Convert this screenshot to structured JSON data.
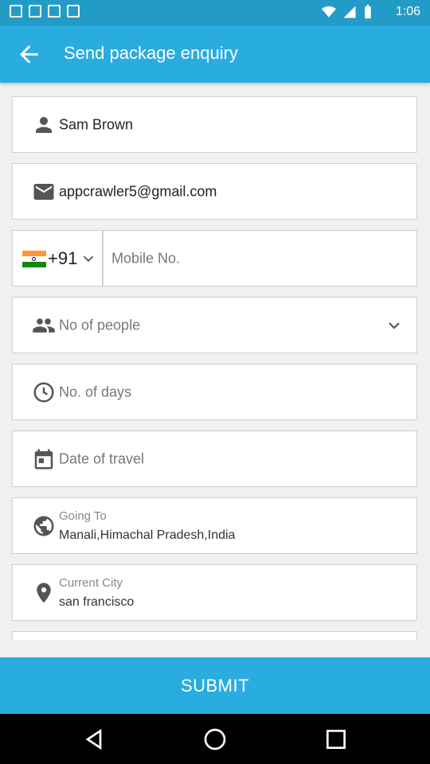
{
  "status_bar": {
    "time": "1:06"
  },
  "app_bar": {
    "back_icon": "arrow-back-icon",
    "title": "Send package enquiry"
  },
  "form": {
    "name": {
      "icon": "person-icon",
      "value": "Sam Brown"
    },
    "email": {
      "icon": "email-icon",
      "value": "appcrawler5@gmail.com"
    },
    "phone": {
      "flag_icon": "india-flag-icon",
      "country_code": "+91",
      "placeholder": "Mobile No."
    },
    "people": {
      "icon": "people-icon",
      "placeholder": "No of people"
    },
    "days": {
      "icon": "clock-icon",
      "placeholder": "No. of days"
    },
    "date": {
      "icon": "calendar-icon",
      "placeholder": "Date of travel"
    },
    "going_to": {
      "icon": "globe-icon",
      "label": "Going To",
      "value": "Manali,Himachal Pradesh,India"
    },
    "current_city": {
      "icon": "location-pin-icon",
      "label": "Current City",
      "value": "san francisco"
    }
  },
  "submit_label": "SUBMIT",
  "colors": {
    "primary": "#29ace0",
    "status_bar": "#229cc6",
    "flag_saffron": "#ff9933",
    "flag_green": "#138808"
  }
}
